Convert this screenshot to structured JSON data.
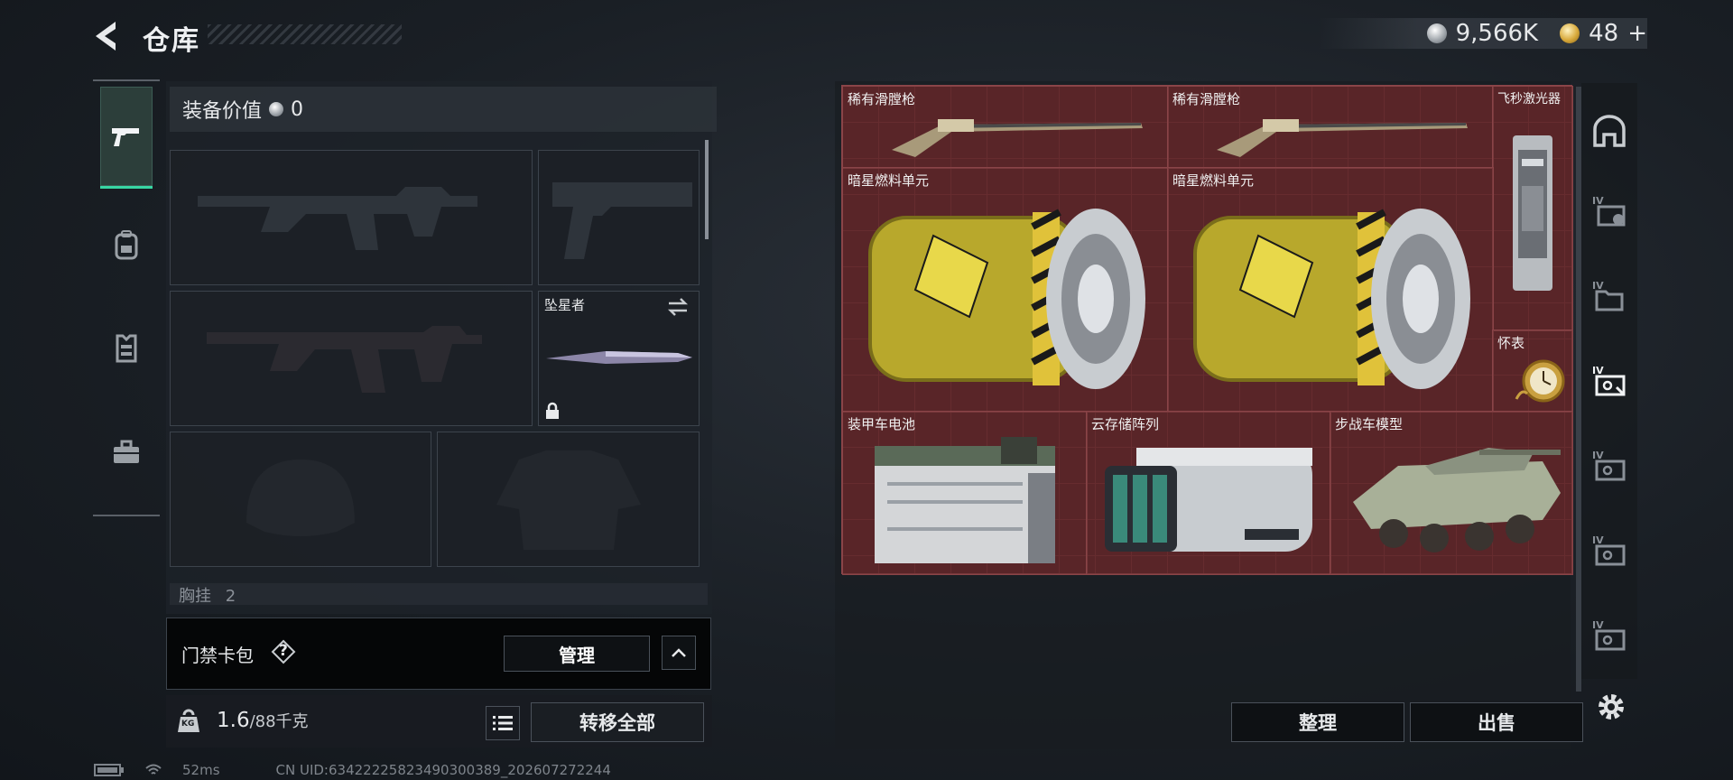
{
  "header": {
    "title": "仓库",
    "silver_amount": "9,566K",
    "gold_amount": "48",
    "gold_plus": "+"
  },
  "left_tabs": [
    {
      "icon": "pistol-icon",
      "active": true
    },
    {
      "icon": "backpack-icon",
      "active": false
    },
    {
      "icon": "vest-icon",
      "active": false
    },
    {
      "icon": "toolbox-icon",
      "active": false
    }
  ],
  "equipment": {
    "value_label": "装备价值",
    "value_amount": "0",
    "melee_slot_label": "坠星者",
    "chest_rig_label": "胸挂",
    "chest_rig_count": "2"
  },
  "keycard": {
    "label": "门禁卡包",
    "help": "?",
    "manage_label": "管理"
  },
  "weight": {
    "current": "1.6",
    "max": "/88千克",
    "kg_label": "KG"
  },
  "actions": {
    "transfer_all": "转移全部",
    "sort": "整理",
    "sell": "出售"
  },
  "storage_items": [
    {
      "name": "稀有滑膛枪"
    },
    {
      "name": "稀有滑膛枪"
    },
    {
      "name": "飞秒激光器"
    },
    {
      "name": "暗星燃料单元"
    },
    {
      "name": "暗星燃料单元"
    },
    {
      "name": "怀表"
    },
    {
      "name": "装甲车电池"
    },
    {
      "name": "云存储阵列"
    },
    {
      "name": "步战车模型"
    }
  ],
  "storage_tab_label": "IV",
  "status_bar": {
    "ping": "52ms",
    "uid": "CN UID:63422225823490300389_202607272244"
  },
  "colors": {
    "accent": "#38d6a3",
    "grid_bg": "#5a2628"
  }
}
